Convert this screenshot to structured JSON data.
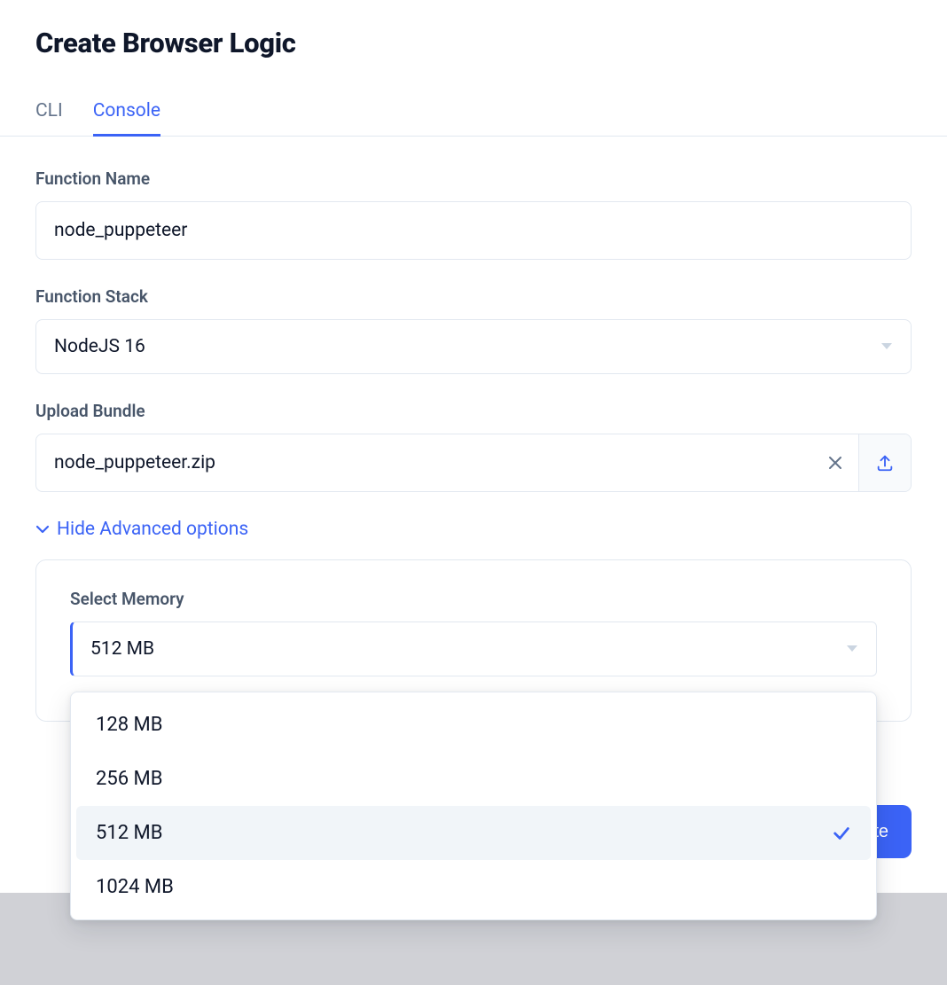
{
  "header": {
    "title": "Create Browser Logic"
  },
  "tabs": [
    {
      "label": "CLI",
      "active": false
    },
    {
      "label": "Console",
      "active": true
    }
  ],
  "form": {
    "function_name": {
      "label": "Function Name",
      "value": "node_puppeteer"
    },
    "function_stack": {
      "label": "Function Stack",
      "value": "NodeJS 16"
    },
    "upload_bundle": {
      "label": "Upload Bundle",
      "filename": "node_puppeteer.zip"
    },
    "advanced_toggle": "Hide Advanced options",
    "memory": {
      "label": "Select Memory",
      "value": "512 MB",
      "options": [
        "128 MB",
        "256 MB",
        "512 MB",
        "1024 MB"
      ],
      "selected_index": 2
    }
  },
  "actions": {
    "create": "Create"
  }
}
